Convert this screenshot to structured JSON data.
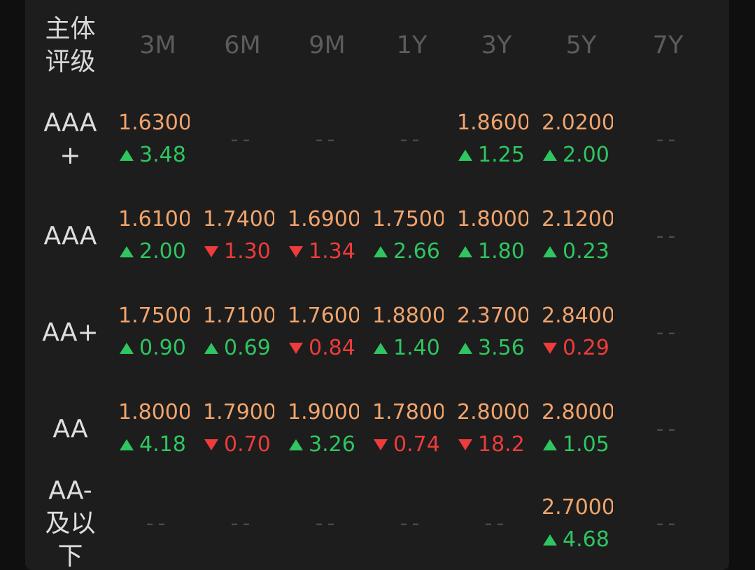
{
  "header": {
    "rating_label": "主体\n评级",
    "terms": [
      "3M",
      "6M",
      "9M",
      "1Y",
      "3Y",
      "5Y",
      "7Y"
    ]
  },
  "empty_marker": "--",
  "colors": {
    "value": "#f1a46c",
    "up": "#2fc560",
    "down": "#ee3b3b",
    "header": "#5c5c5c"
  },
  "rows": [
    {
      "rating": "AAA\n+",
      "cells": [
        {
          "value": "1.6300",
          "change": "3.48",
          "dir": "up"
        },
        null,
        null,
        null,
        {
          "value": "1.8600",
          "change": "1.25",
          "dir": "up"
        },
        {
          "value": "2.0200",
          "change": "2.00",
          "dir": "up"
        },
        null
      ]
    },
    {
      "rating": "AAA",
      "cells": [
        {
          "value": "1.6100",
          "change": "2.00",
          "dir": "up"
        },
        {
          "value": "1.7400",
          "change": "1.30",
          "dir": "down"
        },
        {
          "value": "1.6900",
          "change": "1.34",
          "dir": "down"
        },
        {
          "value": "1.7500",
          "change": "2.66",
          "dir": "up"
        },
        {
          "value": "1.8000",
          "change": "1.80",
          "dir": "up"
        },
        {
          "value": "2.1200",
          "change": "0.23",
          "dir": "up"
        },
        null
      ]
    },
    {
      "rating": "AA+",
      "cells": [
        {
          "value": "1.7500",
          "change": "0.90",
          "dir": "up"
        },
        {
          "value": "1.7100",
          "change": "0.69",
          "dir": "up"
        },
        {
          "value": "1.7600",
          "change": "0.84",
          "dir": "down"
        },
        {
          "value": "1.8800",
          "change": "1.40",
          "dir": "up"
        },
        {
          "value": "2.3700",
          "change": "3.56",
          "dir": "up"
        },
        {
          "value": "2.8400",
          "change": "0.29",
          "dir": "down"
        },
        null
      ]
    },
    {
      "rating": "AA",
      "cells": [
        {
          "value": "1.8000",
          "change": "4.18",
          "dir": "up"
        },
        {
          "value": "1.7900",
          "change": "0.70",
          "dir": "down"
        },
        {
          "value": "1.9000",
          "change": "3.26",
          "dir": "up"
        },
        {
          "value": "1.7800",
          "change": "0.74",
          "dir": "down"
        },
        {
          "value": "2.8000",
          "change": "18.2",
          "dir": "down"
        },
        {
          "value": "2.8000",
          "change": "1.05",
          "dir": "up"
        },
        null
      ]
    },
    {
      "rating": "AA-\n及以\n下",
      "cells": [
        null,
        null,
        null,
        null,
        null,
        {
          "value": "2.7000",
          "change": "4.68",
          "dir": "up"
        },
        null
      ]
    }
  ]
}
